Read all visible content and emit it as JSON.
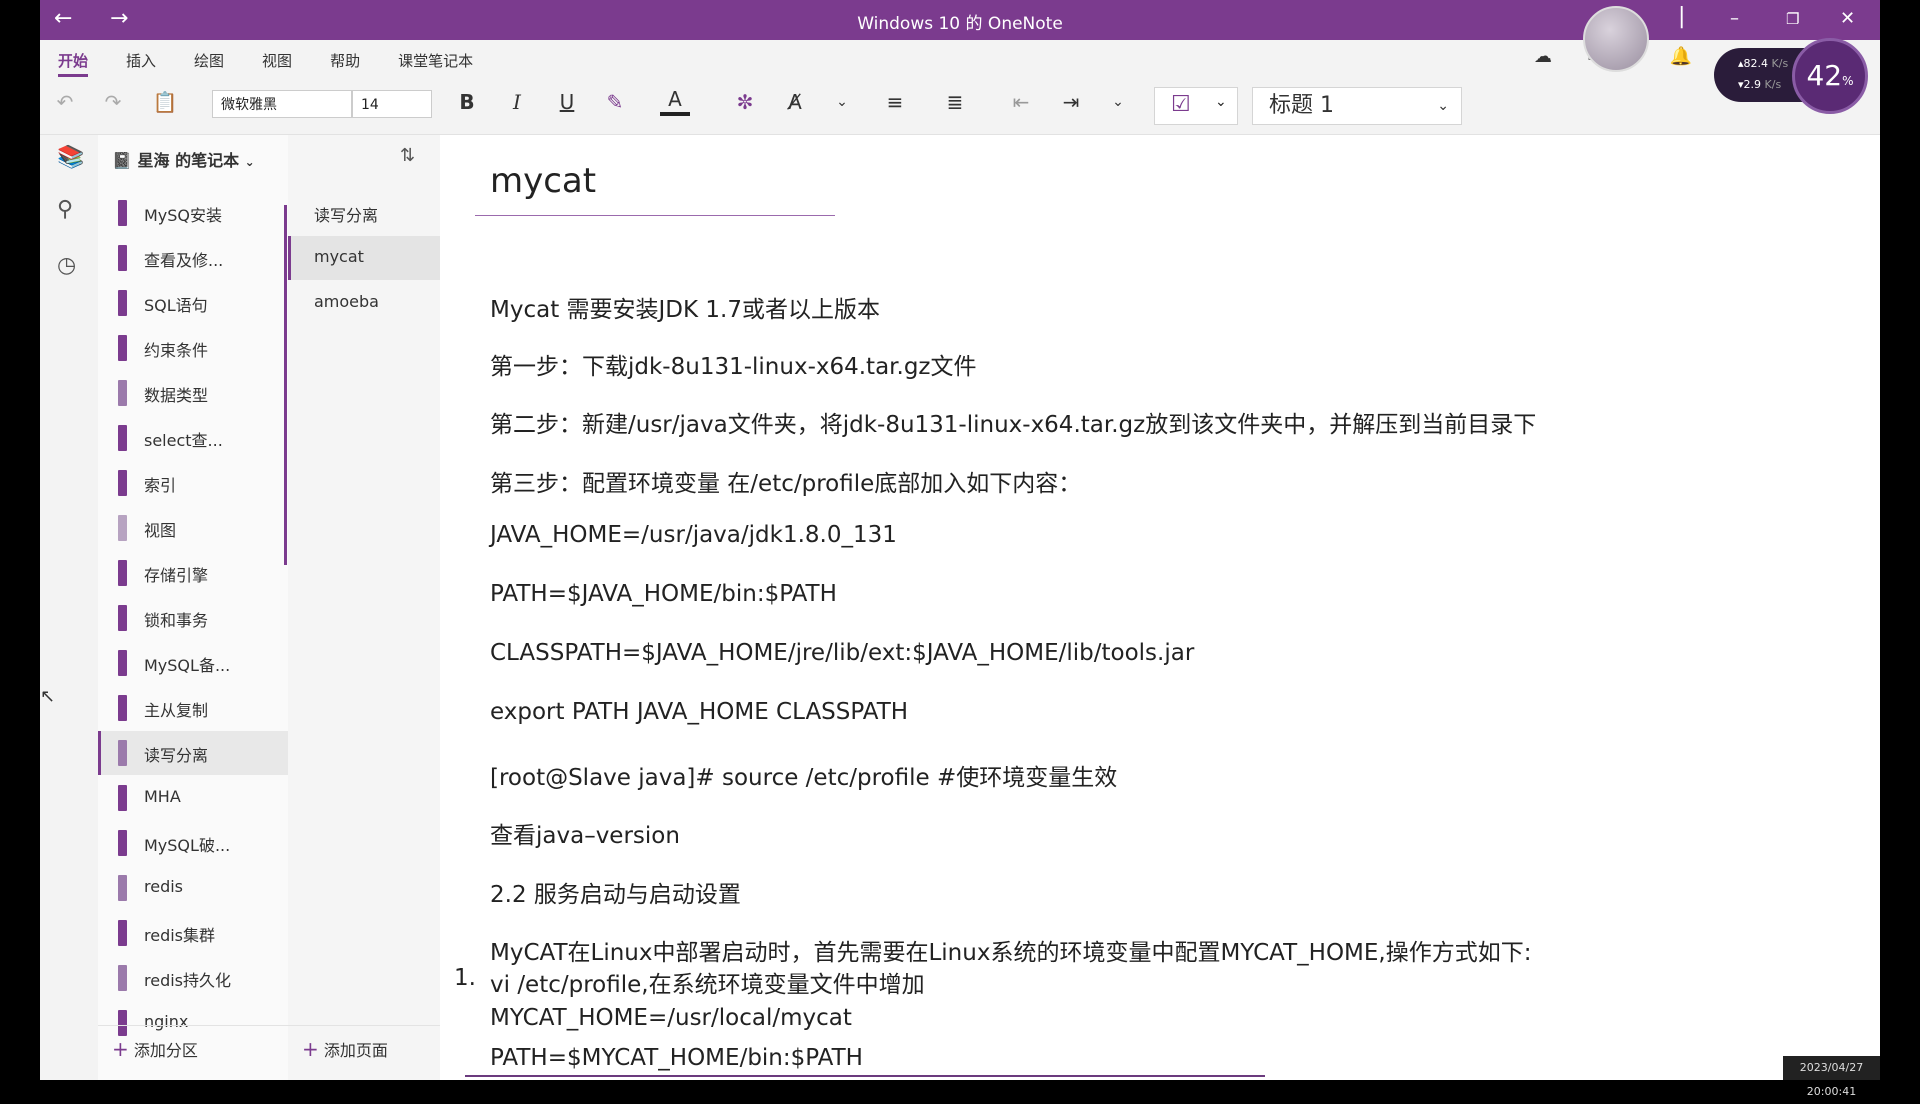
{
  "window": {
    "title": "Windows 10 的 OneNote"
  },
  "ribbon": {
    "tabs": [
      "开始",
      "插入",
      "绘图",
      "视图",
      "帮助",
      "课堂笔记本"
    ],
    "font_name": "微软雅黑",
    "font_size": "14",
    "style": "标题 1",
    "net_speed": {
      "up": "82.4",
      "down": "2.9",
      "unit": "K/s"
    },
    "percent": "42",
    "percent_unit": "%"
  },
  "notebook": {
    "title": "星海 的笔记本",
    "sections": [
      "MySQ安装",
      "查看及修...",
      "SQL语句",
      "约束条件",
      "数据类型",
      "select查...",
      "索引",
      "视图",
      "存储引擎",
      "锁和事务",
      "MySQL备...",
      "主从复制",
      "读写分离",
      "MHA",
      "MySQL破...",
      "redis",
      "redis集群",
      "redis持久化",
      "nginx"
    ],
    "selected_section": "读写分离",
    "add_section": "添加分区"
  },
  "pages": {
    "items": [
      "读写分离",
      "mycat",
      "amoeba"
    ],
    "selected": "mycat",
    "add_page": "添加页面"
  },
  "page": {
    "title": "mycat",
    "lines": [
      "Mycat 需要安装JDK 1.7或者以上版本",
      "第一步：下载jdk-8u131-linux-x64.tar.gz文件",
      "第二步：新建/usr/java文件夹，将jdk-8u131-linux-x64.tar.gz放到该文件夹中，并解压到当前目录下",
      "第三步：配置环境变量 在/etc/profile底部加入如下内容：",
      "JAVA_HOME=/usr/java/jdk1.8.0_131",
      "PATH=$JAVA_HOME/bin:$PATH",
      "CLASSPATH=$JAVA_HOME/jre/lib/ext:$JAVA_HOME/lib/tools.jar",
      "export PATH JAVA_HOME CLASSPATH",
      "[root@Slave java]# source /etc/profile  #使环境变量生效",
      "查看java–version",
      "2.2 服务启动与启动设置",
      "MyCAT在Linux中部署启动时，首先需要在Linux系统的环境变量中配置MYCAT_HOME,操作方式如下:"
    ],
    "list_number": "1.",
    "list_lines": [
      "vi /etc/profile,在系统环境变量文件中增加",
      "MYCAT_HOME=/usr/local/mycat",
      "PATH=$MYCAT_HOME/bin:$PATH"
    ]
  },
  "timestamp": "2023/04/27 20:00:41"
}
